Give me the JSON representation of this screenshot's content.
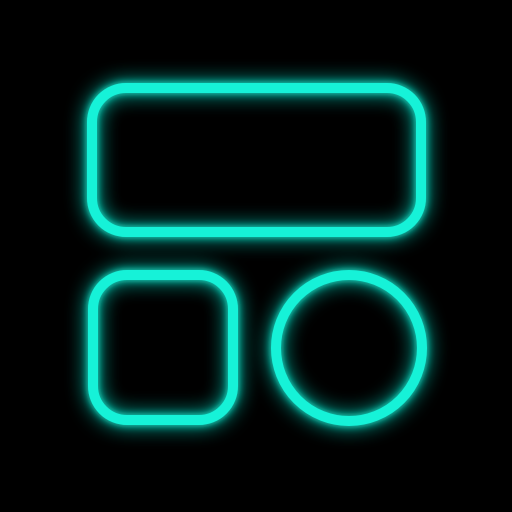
{
  "app_icon": {
    "name": "widget-layout-icon",
    "background_color": "#000000",
    "neon_color": "#19f2d8",
    "glow_color": "#12d9c3",
    "shapes": [
      "wide-rounded-rectangle",
      "rounded-square",
      "circle"
    ]
  }
}
